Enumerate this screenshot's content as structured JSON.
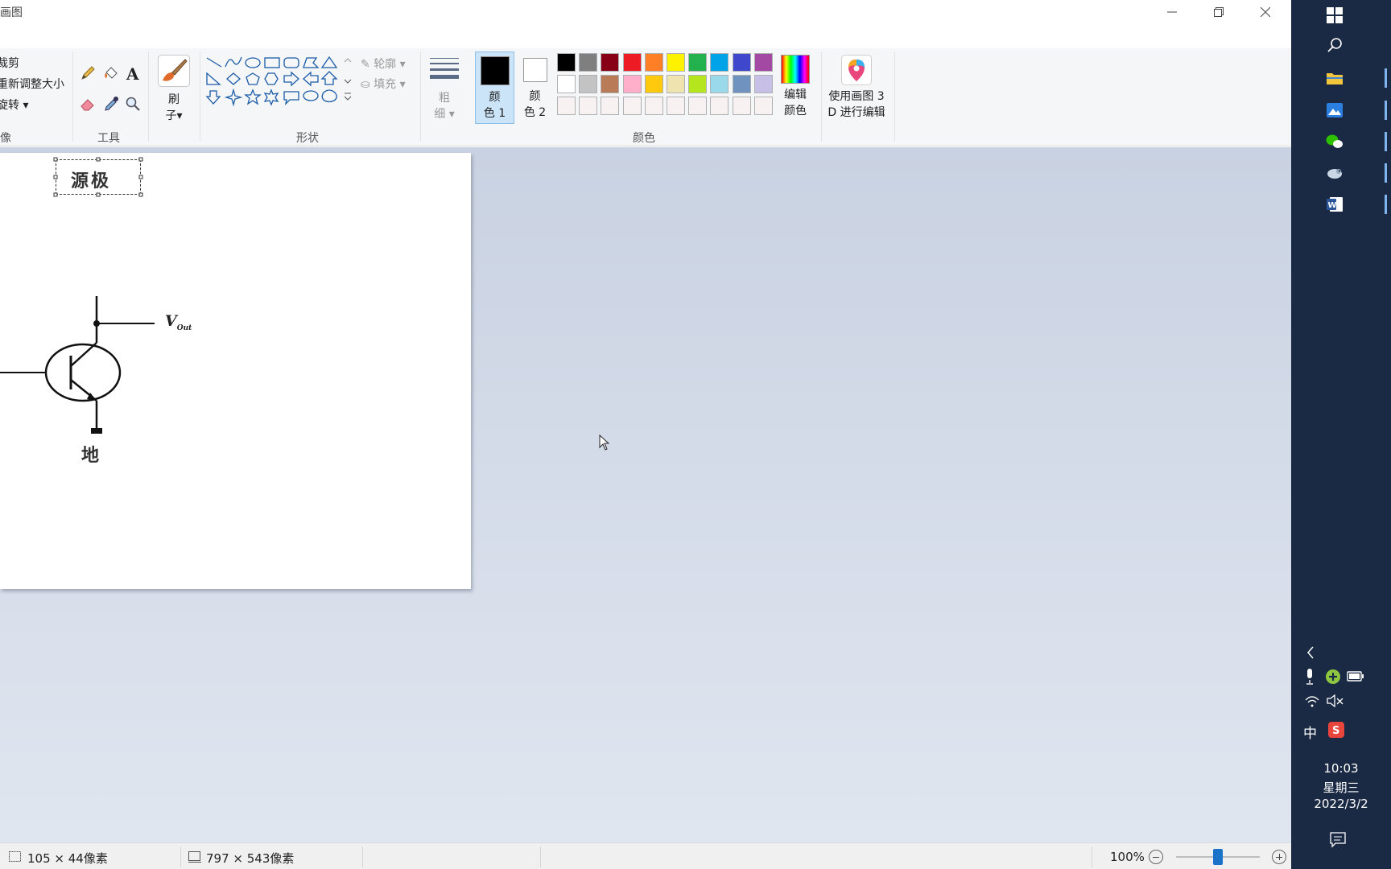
{
  "window": {
    "title": "画图",
    "controls": [
      "minimize",
      "restore",
      "close"
    ]
  },
  "ribbon": {
    "image_group": {
      "label": "像",
      "items": [
        "裁剪",
        "重新调整大小",
        "旋转 ▾"
      ]
    },
    "tools_group": {
      "label": "工具",
      "tools": [
        "pencil-icon",
        "fill-bucket-icon",
        "text-icon",
        "eraser-icon",
        "color-picker-icon",
        "magnifier-icon"
      ]
    },
    "brush": {
      "label_line1": "刷",
      "label_line2": "子▾"
    },
    "shapes_group": {
      "label": "形状",
      "outline_label": "轮廓 ▾",
      "fill_label": "填充 ▾"
    },
    "size": {
      "label_line1": "粗",
      "label_line2": "细 ▾"
    },
    "color1": {
      "label_line1": "颜",
      "label_line2": "色 1",
      "color": "#000000"
    },
    "color2": {
      "label_line1": "颜",
      "label_line2": "色 2",
      "color": "#ffffff"
    },
    "colors_group": {
      "label": "颜色",
      "palette_row1": [
        "#000000",
        "#7f7f7f",
        "#880015",
        "#ed1c24",
        "#ff7f27",
        "#fff200",
        "#22b14c",
        "#00a2e8",
        "#3f48cc",
        "#a349a4"
      ],
      "palette_row2": [
        "#ffffff",
        "#c3c3c3",
        "#b97a57",
        "#ffaec9",
        "#ffc90e",
        "#efe4b0",
        "#b5e61d",
        "#99d9ea",
        "#7092be",
        "#c8bfe7"
      ],
      "palette_row3": [
        "#f7f1f1",
        "#f7f1f1",
        "#f7f1f1",
        "#f7f1f1",
        "#f7f1f1",
        "#f7f1f1",
        "#f7f1f1",
        "#f7f1f1",
        "#f7f1f1",
        "#f7f1f1"
      ]
    },
    "edit_colors": {
      "label_line1": "编辑",
      "label_line2": "颜色"
    },
    "paint3d": {
      "label_line1": "使用画图 3",
      "label_line2": "D 进行编辑"
    }
  },
  "canvas": {
    "selection_text": "源极",
    "vout_label": "V",
    "vout_subscript": "Out",
    "ground_label": "地"
  },
  "status": {
    "selection_size": "105 × 44像素",
    "image_size": "797 × 543像素",
    "zoom": "100%",
    "zoom_level_fraction": 0.5
  },
  "taskbar": {
    "apps": [
      "windows-start-icon",
      "search-icon",
      "file-explorer-icon",
      "photos-icon",
      "wechat-icon",
      "app-bird-icon",
      "word-icon"
    ],
    "tray": {
      "ime": "中",
      "time": "10:03",
      "weekday": "星期三",
      "date": "2022/3/2"
    }
  }
}
